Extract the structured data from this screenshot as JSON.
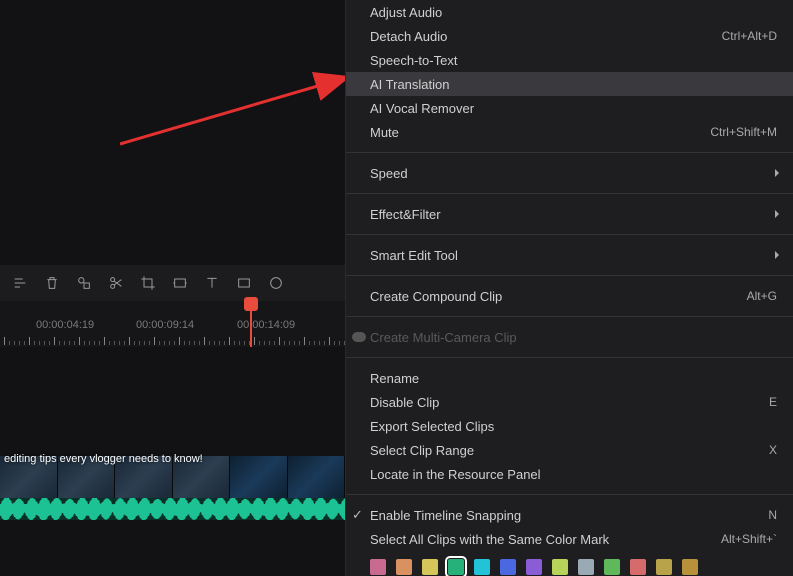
{
  "preview": {},
  "toolbar": {
    "icons": [
      "adjust",
      "trash",
      "shapes",
      "scissors",
      "crop",
      "stabilize",
      "text",
      "rectangle",
      "ellipse"
    ]
  },
  "ruler": {
    "labels": [
      "00:00:04:19",
      "00:00:09:14",
      "00:00:14:09"
    ],
    "label_positions": [
      36,
      136,
      237
    ]
  },
  "clip": {
    "title": "editing tips every vlogger needs to know!"
  },
  "menu": {
    "items": [
      {
        "label": "Adjust Audio",
        "shortcut": "",
        "type": "item"
      },
      {
        "label": "Detach Audio",
        "shortcut": "Ctrl+Alt+D",
        "type": "item"
      },
      {
        "label": "Speech-to-Text",
        "shortcut": "",
        "type": "item"
      },
      {
        "label": "AI Translation",
        "shortcut": "",
        "type": "item",
        "highlighted": true
      },
      {
        "label": "AI Vocal Remover",
        "shortcut": "",
        "type": "item"
      },
      {
        "label": "Mute",
        "shortcut": "Ctrl+Shift+M",
        "type": "item"
      },
      {
        "type": "sep"
      },
      {
        "label": "Speed",
        "shortcut": "",
        "type": "submenu"
      },
      {
        "type": "sep"
      },
      {
        "label": "Effect&Filter",
        "shortcut": "",
        "type": "submenu"
      },
      {
        "type": "sep"
      },
      {
        "label": "Smart Edit Tool",
        "shortcut": "",
        "type": "submenu"
      },
      {
        "type": "sep"
      },
      {
        "label": "Create Compound Clip",
        "shortcut": "Alt+G",
        "type": "item"
      },
      {
        "type": "sep"
      },
      {
        "label": "Create Multi-Camera Clip",
        "shortcut": "",
        "type": "item",
        "disabled": true,
        "iconLeft": true
      },
      {
        "type": "sep"
      },
      {
        "label": "Rename",
        "shortcut": "",
        "type": "item"
      },
      {
        "label": "Disable Clip",
        "shortcut": "E",
        "type": "item"
      },
      {
        "label": "Export Selected Clips",
        "shortcut": "",
        "type": "item"
      },
      {
        "label": "Select Clip Range",
        "shortcut": "X",
        "type": "item"
      },
      {
        "label": "Locate in the Resource Panel",
        "shortcut": "",
        "type": "item"
      },
      {
        "type": "sep"
      },
      {
        "label": "Enable Timeline Snapping",
        "shortcut": "N",
        "type": "item",
        "checked": true
      },
      {
        "label": "Select All Clips with the Same Color Mark",
        "shortcut": "Alt+Shift+`",
        "type": "item"
      }
    ],
    "colors": [
      {
        "hex": "#c96b90",
        "selected": false
      },
      {
        "hex": "#d9915f",
        "selected": false
      },
      {
        "hex": "#d6c65a",
        "selected": false
      },
      {
        "hex": "#26b07a",
        "selected": true
      },
      {
        "hex": "#22c3d6",
        "selected": false
      },
      {
        "hex": "#4a68e0",
        "selected": false
      },
      {
        "hex": "#8a5cd6",
        "selected": false
      },
      {
        "hex": "#b7d35a",
        "selected": false
      },
      {
        "hex": "#9aaab5",
        "selected": false
      },
      {
        "hex": "#5fb85a",
        "selected": false
      },
      {
        "hex": "#d66b6b",
        "selected": false
      },
      {
        "hex": "#b8a24a",
        "selected": false
      },
      {
        "hex": "#b8923a",
        "selected": false
      }
    ]
  }
}
